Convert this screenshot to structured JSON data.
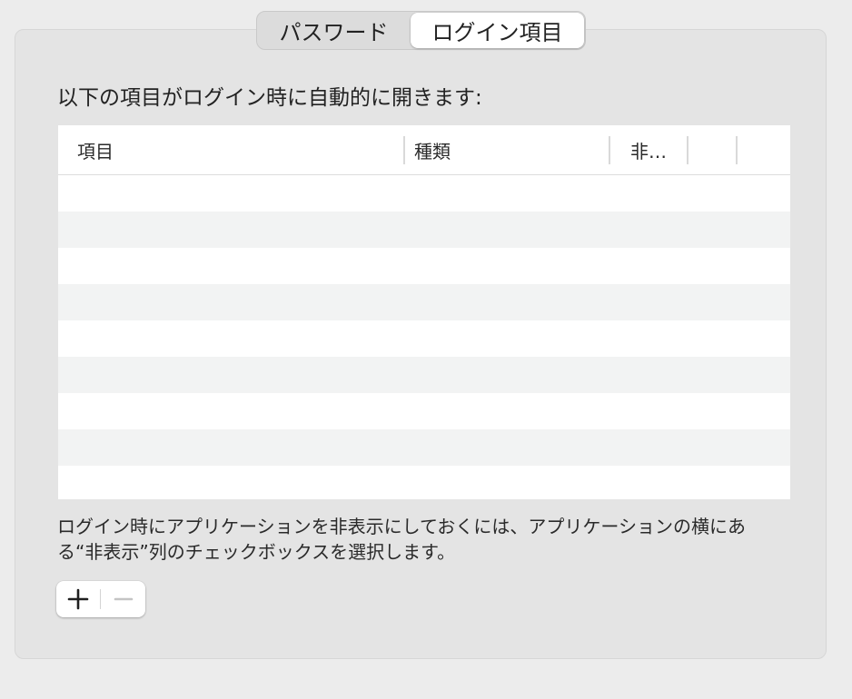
{
  "tabs": [
    {
      "label": "パスワード",
      "selected": false
    },
    {
      "label": "ログイン項目",
      "selected": true
    }
  ],
  "heading": "以下の項目がログイン時に自動的に開きます:",
  "table": {
    "columns": [
      "項目",
      "種類",
      "非…",
      "",
      ""
    ],
    "rows": []
  },
  "note": "ログイン時にアプリケーションを非表示にしておくには、アプリケーションの横にある“非表示”列のチェックボックスを選択します。",
  "buttons": {
    "add_icon": "plus-icon",
    "remove_icon": "minus-icon",
    "remove_enabled": false
  },
  "colors": {
    "panel_bg": "#e4e4e4",
    "window_bg": "#ececec",
    "row_alt": "#f2f3f3",
    "disabled_icon": "#c4c4c4"
  }
}
